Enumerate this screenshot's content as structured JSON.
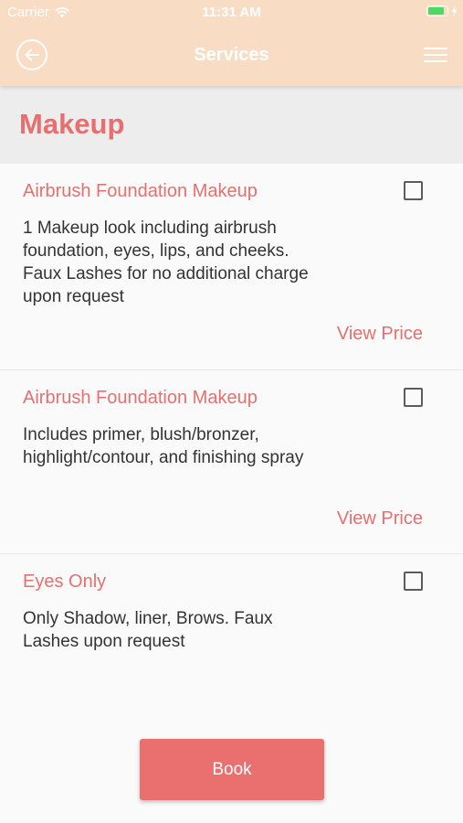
{
  "status_bar": {
    "carrier": "Carrier",
    "time": "11:31 AM",
    "battery_level": 0.85
  },
  "nav": {
    "title": "Services"
  },
  "section": {
    "title": "Makeup"
  },
  "items": [
    {
      "title": "Airbrush Foundation Makeup",
      "description": "1 Makeup look including airbrush foundation, eyes, lips, and cheeks. Faux Lashes for no additional charge upon request",
      "action": "View Price",
      "checked": false
    },
    {
      "title": "Airbrush Foundation Makeup",
      "description": "Includes primer, blush/bronzer, highlight/contour, and finishing spray",
      "action": "View Price",
      "checked": false
    },
    {
      "title": "Eyes Only",
      "description": "Only Shadow, liner, Brows. Faux Lashes upon request",
      "checked": false
    }
  ],
  "book_button": {
    "label": "Book"
  },
  "colors": {
    "accent": "#e86f6f",
    "header_bg": "#f9dcc4",
    "button_bg": "#ea7070"
  }
}
